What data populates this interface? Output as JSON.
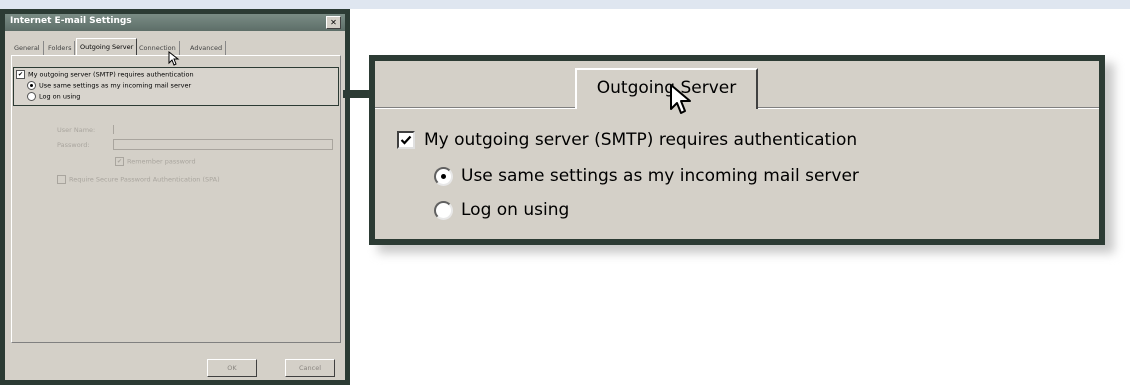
{
  "dialog": {
    "title": "Internet E-mail Settings",
    "close_glyph": "✕",
    "tabs": [
      {
        "label": "General"
      },
      {
        "label": "Folders"
      },
      {
        "label": "Outgoing Server"
      },
      {
        "label": "Connection"
      },
      {
        "label": "Advanced"
      }
    ],
    "active_tab": "Outgoing Server",
    "auth_checkbox_label": "My outgoing server (SMTP) requires authentication",
    "auth_checked": true,
    "radio_same_label": "Use same settings as my incoming mail server",
    "radio_logon_label": "Log on using",
    "selected_radio": "same",
    "user_name_label": "User Name:",
    "password_label": "Password:",
    "remember_password_label": "Remember password",
    "spa_label": "Require Secure Password Authentication (SPA)",
    "ok_label": "OK",
    "cancel_label": "Cancel"
  },
  "zoom": {
    "tab_label": "Outgoing Server",
    "auth_checkbox_label": "My outgoing server (SMTP) requires authentication",
    "radio_same_label": "Use same settings as my incoming mail server",
    "radio_logon_label": "Log on using"
  },
  "colors": {
    "frame": "#2c3b34",
    "dialog_face": "#d4d0c8",
    "disabled_text": "#a9a59e",
    "top_band": "#dfe6f0"
  },
  "icons": {
    "cursor": "mouse-pointer-icon",
    "check": "check-mark-icon",
    "close": "close-icon"
  }
}
